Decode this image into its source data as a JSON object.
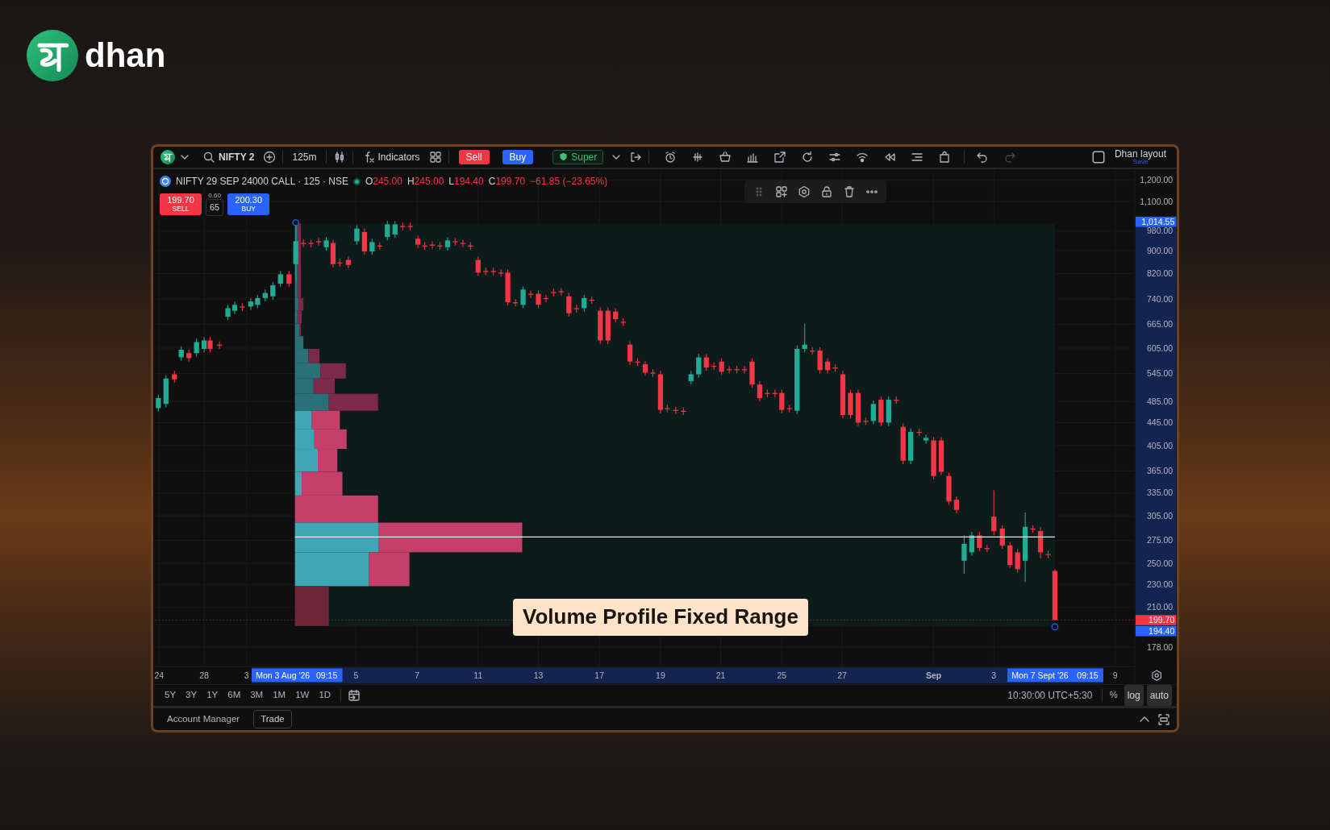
{
  "brand": {
    "name": "dhan"
  },
  "toolbar": {
    "symbol": "NIFTY 2",
    "interval": "125m",
    "indicators": "Indicators",
    "sell": "Sell",
    "buy": "Buy",
    "super": "Super",
    "undo": {
      "disabled": false
    },
    "redo": {
      "disabled": true
    },
    "layout": {
      "name": "Dhan layout",
      "action": "Save"
    }
  },
  "legend": {
    "title": "NIFTY 29 SEP 24000 CALL · 125 · NSE",
    "market_open": true,
    "bearish": true,
    "ohlc": [
      {
        "label": "O",
        "value": "245.00"
      },
      {
        "label": "H",
        "value": "245.00"
      },
      {
        "label": "L",
        "value": "194.40"
      },
      {
        "label": "C",
        "value": "199.70"
      }
    ],
    "change": "−61.85 (−23.65%)"
  },
  "quote": {
    "sell": {
      "price": "199.70",
      "label": "SELL"
    },
    "spread": "0.60",
    "quantity": "65",
    "buy": {
      "price": "200.30",
      "label": "BUY"
    }
  },
  "chart": {
    "price_axis": [
      "1,200.00",
      "1,100.00",
      "980.00",
      "900.00",
      "820.00",
      "740.00",
      "665.00",
      "605.00",
      "545.00",
      "485.00",
      "445.00",
      "405.00",
      "365.00",
      "335.00",
      "305.00",
      "275.00",
      "250.00",
      "230.00",
      "210.00",
      "178.00"
    ],
    "price_tags": [
      {
        "value": "1,014.55",
        "color": "#2962ff"
      },
      {
        "value": "199.70",
        "color": "#f23645"
      },
      {
        "value": "194.40",
        "color": "#2962ff"
      }
    ],
    "time_axis": [
      {
        "label": "24",
        "kind": "day"
      },
      {
        "label": "28",
        "kind": "day"
      },
      {
        "label": "3",
        "kind": "day"
      },
      {
        "label": "5",
        "kind": "day"
      },
      {
        "label": "7",
        "kind": "day"
      },
      {
        "label": "11",
        "kind": "day"
      },
      {
        "label": "13",
        "kind": "day"
      },
      {
        "label": "17",
        "kind": "day"
      },
      {
        "label": "19",
        "kind": "day"
      },
      {
        "label": "21",
        "kind": "day"
      },
      {
        "label": "25",
        "kind": "day"
      },
      {
        "label": "27",
        "kind": "day"
      },
      {
        "label": "Sep",
        "kind": "month"
      },
      {
        "label": "3",
        "kind": "day"
      },
      {
        "label": "9",
        "kind": "day"
      }
    ],
    "range_tags": [
      {
        "date": "Mon 3 Aug '26",
        "time": "09:15"
      },
      {
        "date": "Mon 7 Sept '26",
        "time": "09:15"
      }
    ],
    "caption": "Volume Profile Fixed Range"
  },
  "range_bar": {
    "ranges": [
      "5Y",
      "3Y",
      "1Y",
      "6M",
      "3M",
      "1M",
      "1W",
      "1D"
    ],
    "clock": "10:30:00 UTC+5:30",
    "percent": "%",
    "log": "log",
    "auto": "auto"
  },
  "bottom_bar": {
    "tabs": [
      {
        "label": "Account Manager",
        "selected": false
      },
      {
        "label": "Trade",
        "selected": true
      }
    ]
  }
}
